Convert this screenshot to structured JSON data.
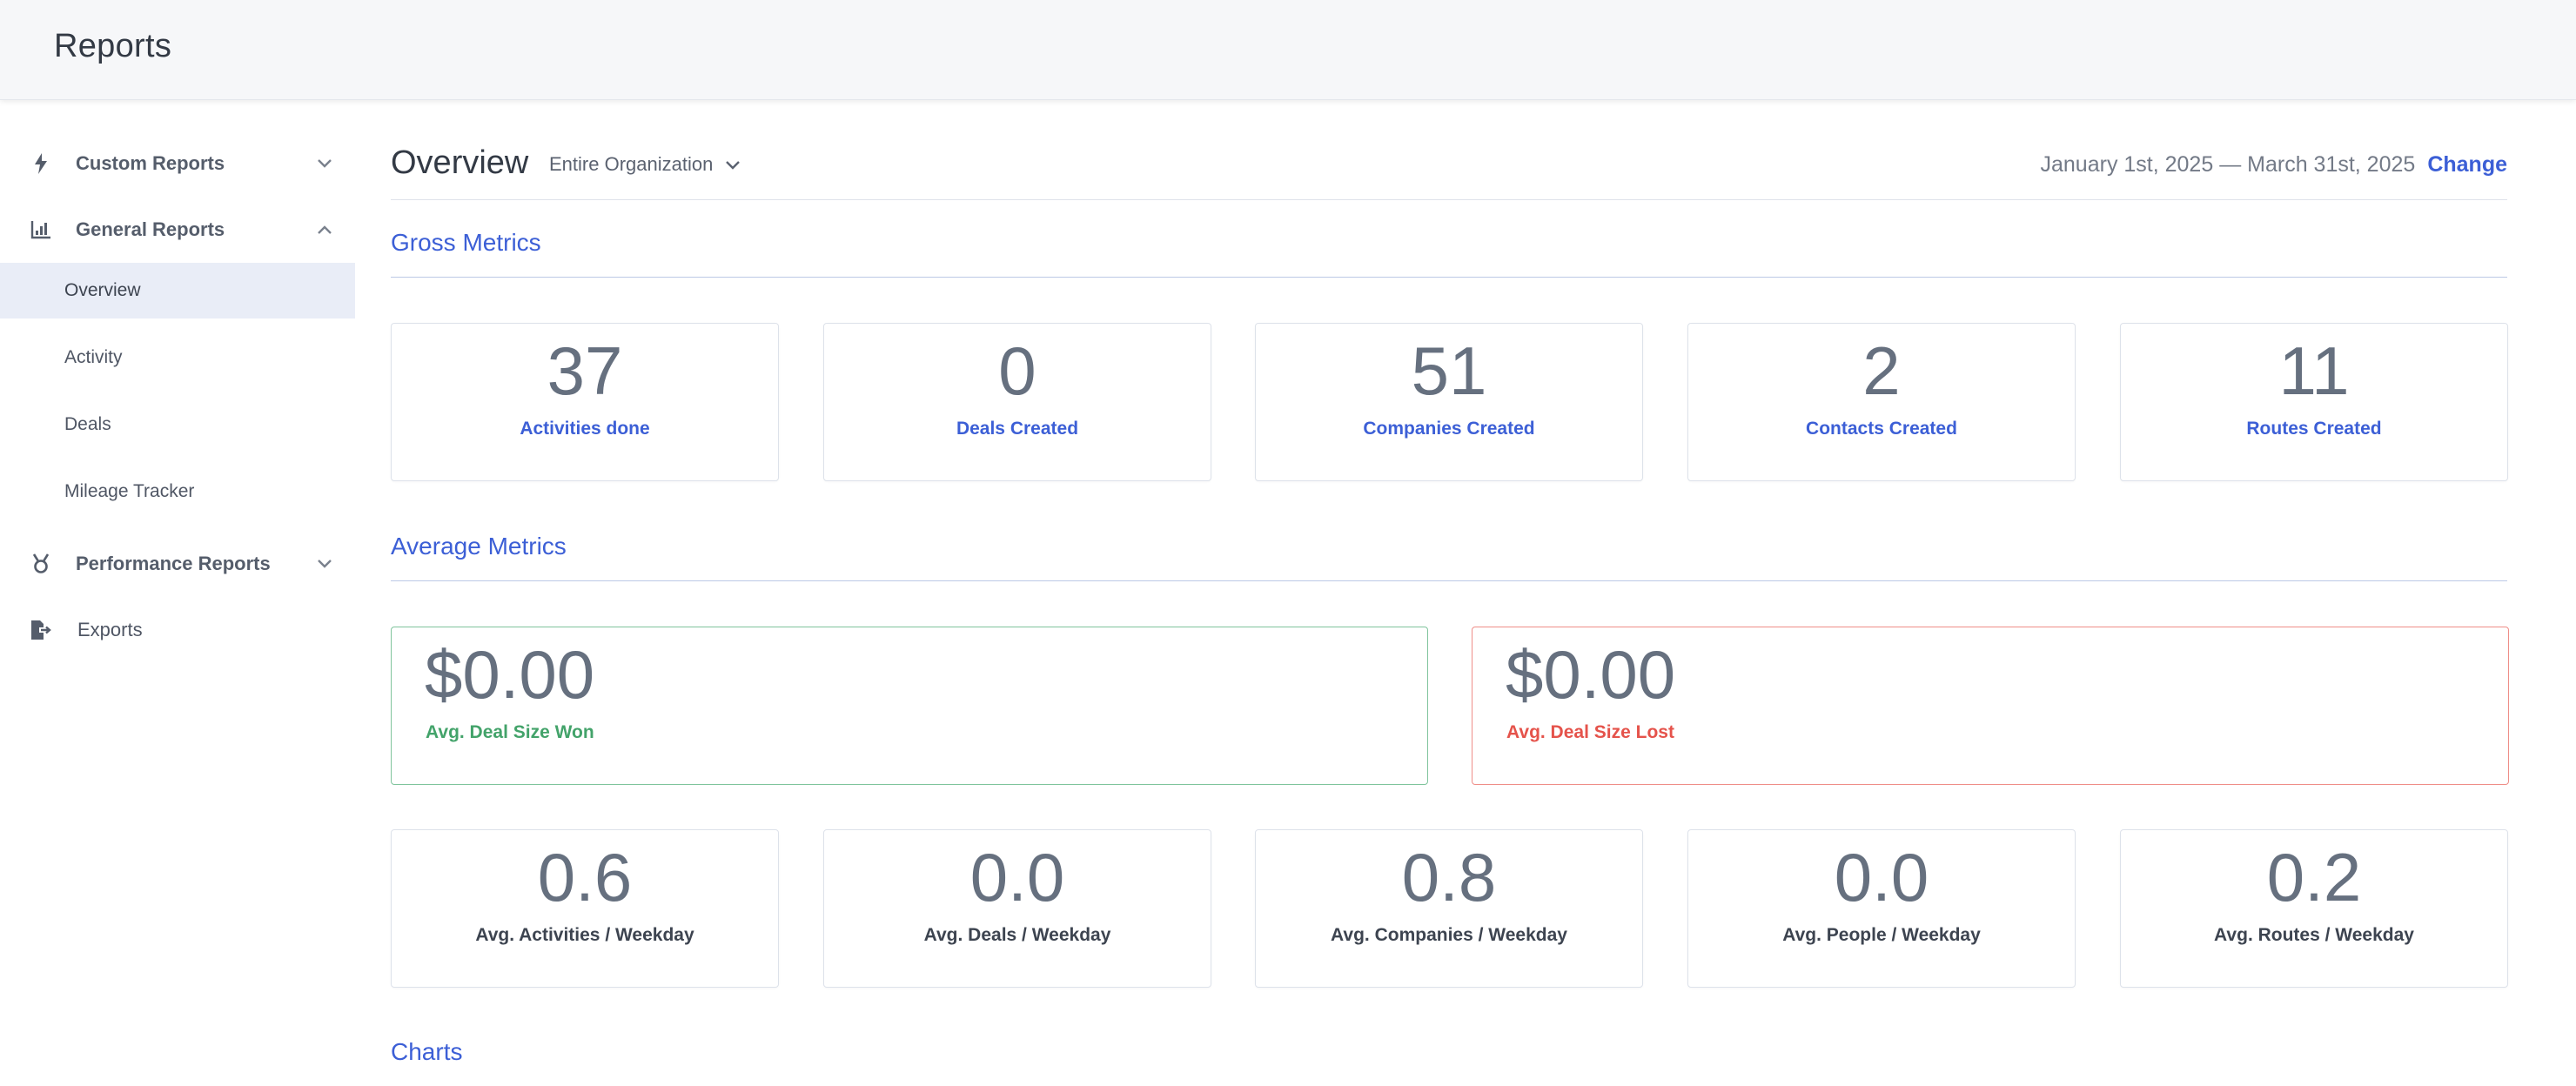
{
  "header": {
    "title": "Reports"
  },
  "sidebar": {
    "items": [
      {
        "label": "Custom Reports",
        "icon": "bolt-icon",
        "expanded": false
      },
      {
        "label": "General Reports",
        "icon": "bar-chart-icon",
        "expanded": true,
        "children": [
          "Overview",
          "Activity",
          "Deals",
          "Mileage Tracker"
        ],
        "active_child": "Overview"
      },
      {
        "label": "Performance Reports",
        "icon": "medal-icon",
        "expanded": false
      },
      {
        "label": "Exports",
        "icon": "export-file-icon"
      }
    ]
  },
  "overview": {
    "title": "Overview",
    "scope": "Entire Organization",
    "date_range": "January 1st, 2025 — March 31st, 2025",
    "change_label": "Change"
  },
  "gross_metrics": {
    "title": "Gross Metrics",
    "cards": [
      {
        "value": "37",
        "label": "Activities done"
      },
      {
        "value": "0",
        "label": "Deals Created"
      },
      {
        "value": "51",
        "label": "Companies Created"
      },
      {
        "value": "2",
        "label": "Contacts Created"
      },
      {
        "value": "11",
        "label": "Routes Created"
      }
    ]
  },
  "average_metrics": {
    "title": "Average Metrics",
    "deal_size": [
      {
        "value": "$0.00",
        "label": "Avg. Deal Size Won",
        "color": "#43a36a"
      },
      {
        "value": "$0.00",
        "label": "Avg. Deal Size Lost",
        "color": "#e5534b"
      }
    ],
    "cards": [
      {
        "value": "0.6",
        "label": "Avg. Activities / Weekday"
      },
      {
        "value": "0.0",
        "label": "Avg. Deals / Weekday"
      },
      {
        "value": "0.8",
        "label": "Avg. Companies / Weekday"
      },
      {
        "value": "0.0",
        "label": "Avg. People / Weekday"
      },
      {
        "value": "0.2",
        "label": "Avg. Routes / Weekday"
      }
    ]
  },
  "charts": {
    "title": "Charts"
  },
  "colors": {
    "accent": "#3c5fd6",
    "won": "#43a36a",
    "lost": "#e5534b",
    "active_bg": "#e9edf7"
  }
}
